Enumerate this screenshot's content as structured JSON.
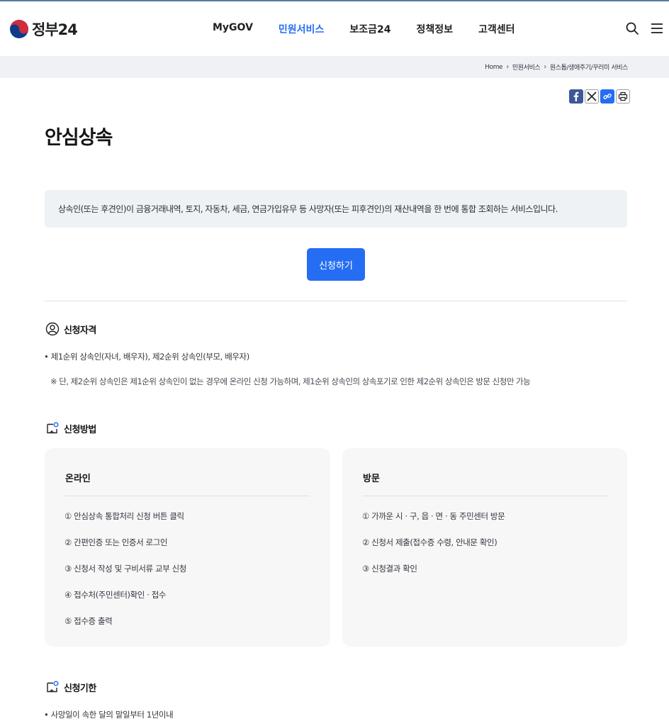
{
  "header": {
    "logo_text": "정부24",
    "nav": [
      "MyGOV",
      "민원서비스",
      "보조금24",
      "정책정보",
      "고객센터"
    ],
    "active_nav_index": 1
  },
  "breadcrumb": [
    "Home",
    "민원서비스",
    "원스톱/생애주기/꾸러미 서비스"
  ],
  "page": {
    "title": "안심상속",
    "summary": "상속인(또는 후견인)이 금융거래내역, 토지, 자동차, 세금, 연금가입유무 등 사망자(또는 피후견인)의 재산내역을 한 번에 통합 조회하는 서비스입니다.",
    "apply_label": "신청하기"
  },
  "sections": {
    "eligibility": {
      "title": "신청자격",
      "bullet": "제1순위 상속인(자녀, 배우자), 제2순위 상속인(부모, 배우자)",
      "note": "※ 단, 제2순위 상속인은 제1순위 상속인이 없는 경우에 온라인 신청 가능하며, 제1순위 상속인의 상속포기로 인한 제2순위 상속인은 방문 신청만 가능"
    },
    "method": {
      "title": "신청방법",
      "online": {
        "title": "온라인",
        "steps": [
          "① 안심상속 통합처리 신청 버튼 클릭",
          "② 간편인증 또는 인증서 로그인",
          "③ 신청서 작성 및 구비서류 교부 신청",
          "④ 접수처(주민센터)확인 · 접수",
          "⑤ 접수증 출력"
        ]
      },
      "visit": {
        "title": "방문",
        "steps": [
          "① 가까운 시 · 구, 읍 · 면 · 동 주민센터 방문",
          "② 신청서 제출(접수증 수령, 안내문 확인)",
          "③ 신청결과 확인"
        ]
      }
    },
    "deadline": {
      "title": "신청기한",
      "bullet": "사망일이 속한 달의 말일부터 1년이내"
    }
  },
  "colors": {
    "accent": "#256ef4",
    "summary_bg": "#eef2f5",
    "card_bg": "#f7f7f8",
    "breadcrumb_bg": "#eff1f4"
  },
  "icons": [
    "search-icon",
    "menu-icon",
    "facebook-icon",
    "x-icon",
    "link-icon",
    "print-icon",
    "user-icon",
    "document-icon"
  ]
}
